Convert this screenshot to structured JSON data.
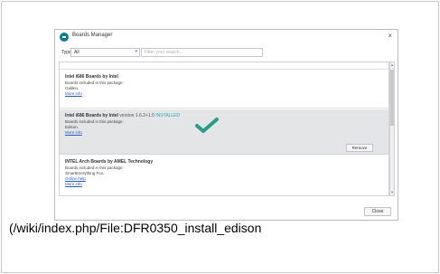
{
  "window": {
    "title": "Boards Manager",
    "close_glyph": "×",
    "app_icon": "arduino-icon"
  },
  "filter": {
    "type_label": "Type",
    "type_value": "All",
    "search_placeholder": "Filter your search..."
  },
  "boards": [
    {
      "title": "Intel i686 Boards by Intel",
      "version": "",
      "status": "",
      "included_label": "Boards included in this package:",
      "boards_list": "Galileo.",
      "links": [
        "More info"
      ]
    },
    {
      "title": "Intel i686 Boards by Intel",
      "version": "version 1.6.2+1.0",
      "status": "INSTALLED",
      "included_label": "Boards included in this package:",
      "boards_list": "Edison.",
      "links": [
        "More info"
      ],
      "button": "Remove"
    },
    {
      "title": "INTEL Arch Boards by AMEL Technology",
      "version": "",
      "status": "",
      "included_label": "Boards included in this package:",
      "boards_list": "SmartEverything Fox.",
      "links": [
        "Online help",
        "More info"
      ]
    }
  ],
  "footer": {
    "close_label": "Close"
  },
  "caption": "(/wiki/index.php/File:DFR0350_install_edison",
  "colors": {
    "selected_row": "#e3e5e6",
    "checkmark": "#2a9d86",
    "link": "#2a57c6",
    "installed": "#2aa9a8"
  }
}
